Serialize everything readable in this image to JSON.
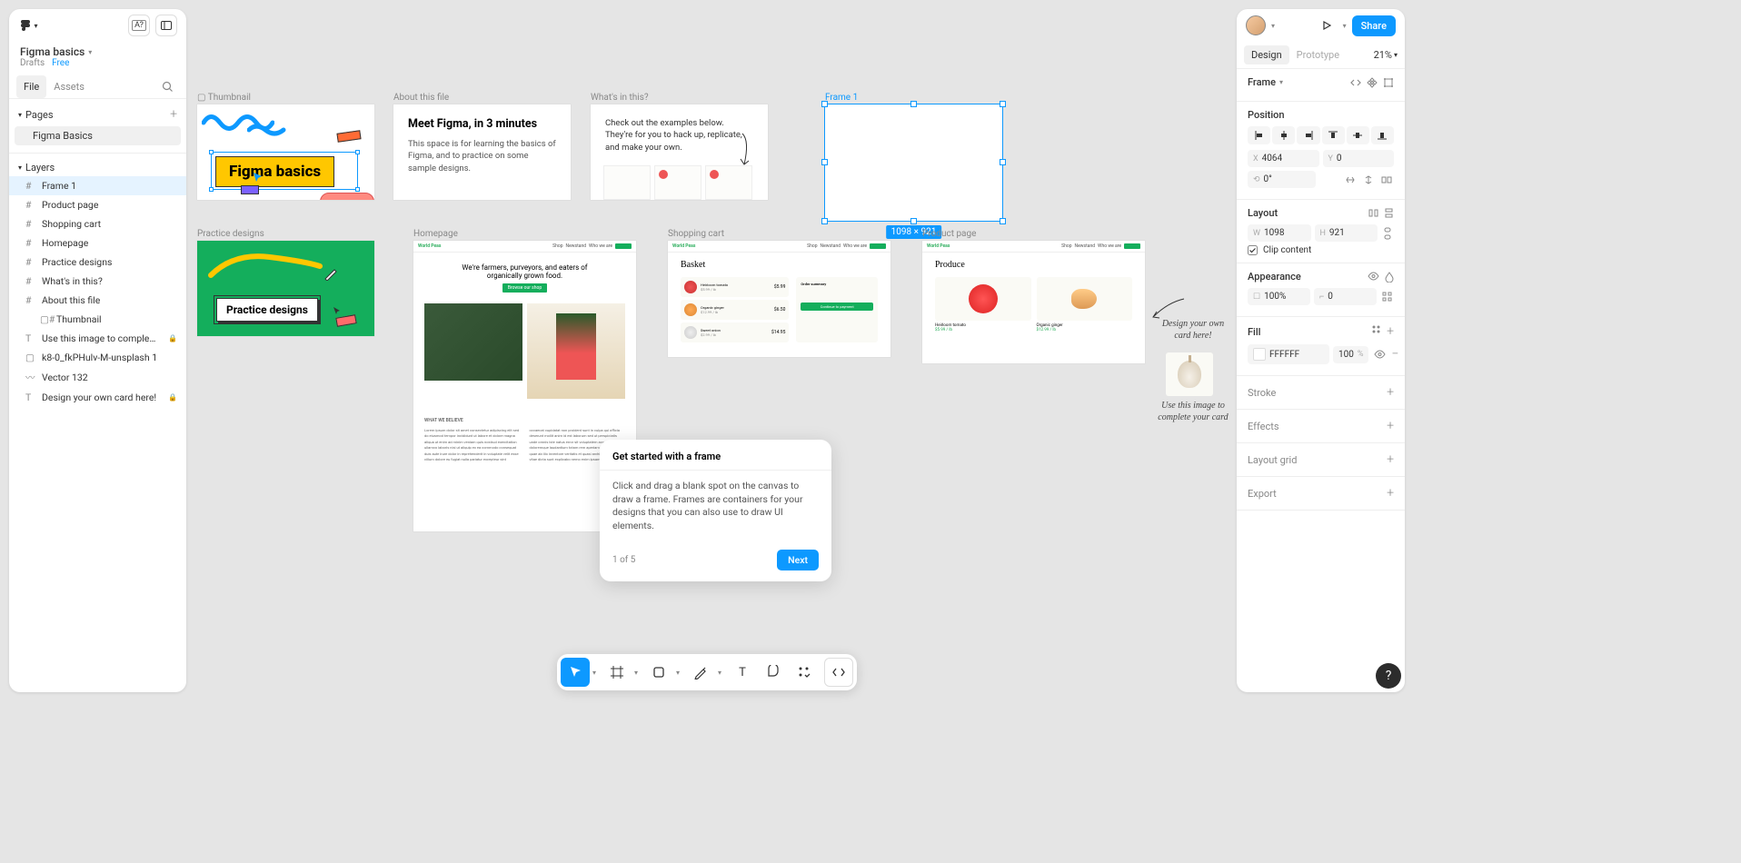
{
  "leftPanel": {
    "title": "Figma basics",
    "breadcrumb": {
      "drafts": "Drafts",
      "free": "Free"
    },
    "tabs": {
      "file": "File",
      "assets": "Assets"
    },
    "pagesLabel": "Pages",
    "page": "Figma Basics",
    "layersLabel": "Layers",
    "layers": [
      {
        "name": "Frame 1",
        "type": "frame",
        "selected": true
      },
      {
        "name": "Product page",
        "type": "frame"
      },
      {
        "name": "Shopping cart",
        "type": "frame"
      },
      {
        "name": "Homepage",
        "type": "frame"
      },
      {
        "name": "Practice designs",
        "type": "frame"
      },
      {
        "name": "What's in this?",
        "type": "frame"
      },
      {
        "name": "About this file",
        "type": "frame"
      },
      {
        "name": "Thumbnail",
        "type": "frame",
        "indent": true,
        "prefix": "▢"
      },
      {
        "name": "Use this image to comple…",
        "type": "text",
        "locked": true
      },
      {
        "name": "k8-0_fkPHulv-M-unsplash 1",
        "type": "image"
      },
      {
        "name": "Vector 132",
        "type": "vector"
      },
      {
        "name": "Design your own card here!",
        "type": "text",
        "locked": true
      }
    ]
  },
  "rightPanel": {
    "share": "Share",
    "tabs": {
      "design": "Design",
      "prototype": "Prototype"
    },
    "zoom": "21%",
    "frameLabel": "Frame",
    "position": {
      "label": "Position",
      "x": "4064",
      "y": "0",
      "rotation": "0°"
    },
    "layout": {
      "label": "Layout",
      "w": "1098",
      "h": "921",
      "clip": "Clip content"
    },
    "appearance": {
      "label": "Appearance",
      "opacity": "100%",
      "radius": "0"
    },
    "fill": {
      "label": "Fill",
      "color": "FFFFFF",
      "opacity": "100",
      "unit": "%"
    },
    "stroke": "Stroke",
    "effects": "Effects",
    "layoutGrid": "Layout grid",
    "export": "Export"
  },
  "canvas": {
    "thumbnail": {
      "label": "Thumbnail",
      "badge": "Figma basics"
    },
    "about": {
      "label": "About this file",
      "title": "Meet Figma, in 3 minutes",
      "text": "This space is for learning the basics of Figma, and to practice on some sample designs."
    },
    "whats": {
      "label": "What's in this?",
      "text": "Check out the examples below. They're for you to hack up, replicate, and make your own."
    },
    "frame1": {
      "label": "Frame 1",
      "dims": "1098 × 921"
    },
    "practice": {
      "label": "Practice designs",
      "badge": "Practice designs"
    },
    "homepage": {
      "label": "Homepage",
      "hero1": "We're farmers, purveyors, and eaters of",
      "hero2": "organically grown food.",
      "btn": "Browse our shop"
    },
    "cart": {
      "label": "Shopping cart",
      "title": "Basket"
    },
    "product": {
      "label": "Product page",
      "title": "Produce"
    },
    "annotation1": "Design your own\ncard here!",
    "annotation2": "Use this image\nto complete\nyour card"
  },
  "tooltip": {
    "title": "Get started with a frame",
    "body": "Click and drag a blank spot on the canvas to draw a frame. Frames are containers for your designs that you can also use to draw UI elements.",
    "step": "1 of 5",
    "next": "Next"
  },
  "help": "?"
}
